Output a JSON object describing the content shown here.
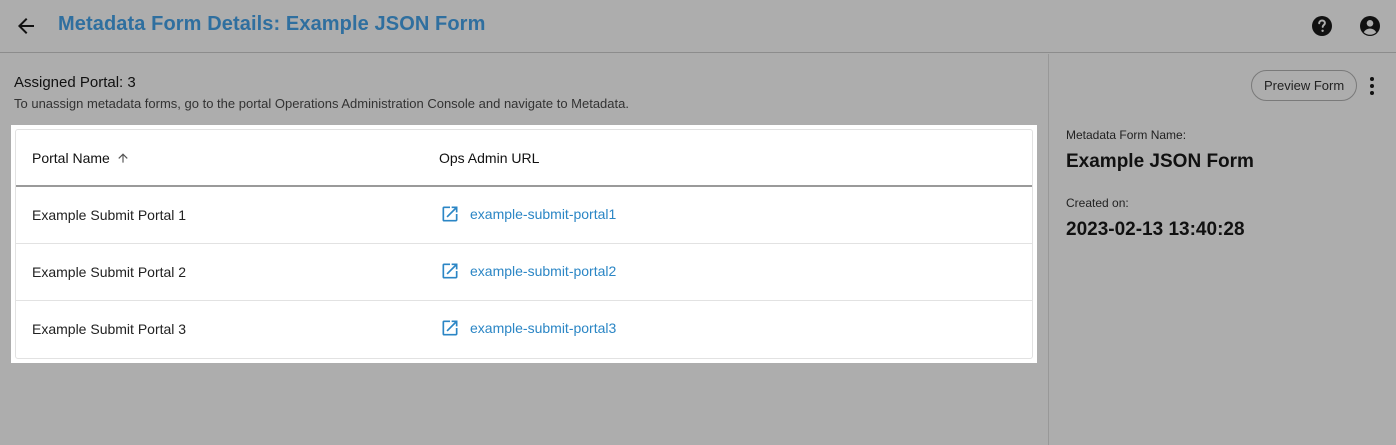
{
  "header": {
    "title": "Metadata Form Details: Example JSON Form",
    "back_icon": "arrow-left-icon",
    "help_icon": "help-circle-icon",
    "account_icon": "account-circle-icon"
  },
  "main": {
    "assigned_title": "Assigned Portal: 3",
    "assigned_hint": "To unassign metadata forms, go to the portal Operations Administration Console and navigate to Metadata.",
    "table": {
      "columns": [
        "Portal Name",
        "Ops Admin URL"
      ],
      "sort_icon": "arrow-up-icon",
      "rows": [
        {
          "name": "Example Submit Portal 1",
          "url": "example-submit-portal1"
        },
        {
          "name": "Example Submit Portal 2",
          "url": "example-submit-portal2"
        },
        {
          "name": "Example Submit Portal 3",
          "url": "example-submit-portal3"
        }
      ]
    }
  },
  "side": {
    "preview_label": "Preview Form",
    "form_name_label": "Metadata Form Name:",
    "form_name": "Example JSON Form",
    "created_label": "Created on:",
    "created_value": "2023-02-13 13:40:28"
  },
  "colors": {
    "title": "#2f6f9f",
    "link": "#2b86c5",
    "background": "#adadad"
  }
}
